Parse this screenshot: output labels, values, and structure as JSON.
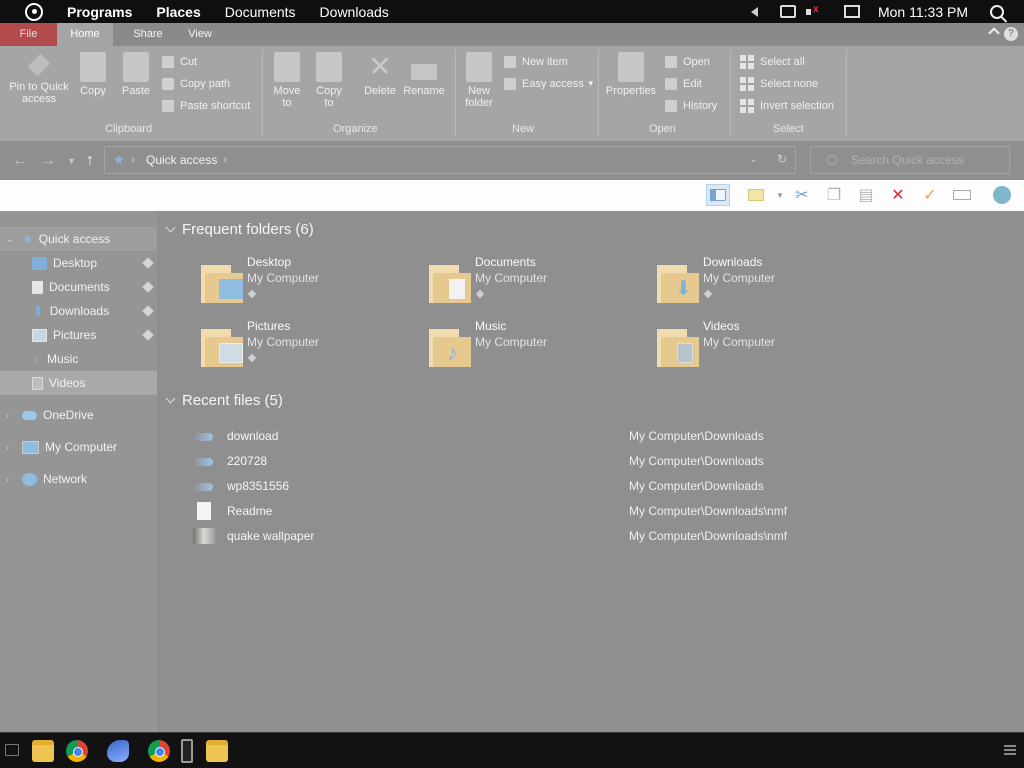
{
  "topbar": {
    "menus": [
      "Programs",
      "Places",
      "Documents",
      "Downloads"
    ],
    "clock": "Mon 11:33 PM"
  },
  "ribbon_tabs": {
    "file": "File",
    "home": "Home",
    "share": "Share",
    "view": "View",
    "help": "?"
  },
  "ribbon": {
    "clipboard": {
      "label": "Clipboard",
      "pin": "Pin to Quick access",
      "copy": "Copy",
      "paste": "Paste",
      "cut": "Cut",
      "copy_path": "Copy path",
      "paste_shortcut": "Paste shortcut"
    },
    "organize": {
      "label": "Organize",
      "move_to": "Move to",
      "copy_to": "Copy to",
      "delete": "Delete",
      "rename": "Rename"
    },
    "new": {
      "label": "New",
      "new_folder": "New folder",
      "new_item": "New item",
      "easy_access": "Easy access"
    },
    "open": {
      "label": "Open",
      "properties": "Properties",
      "open": "Open",
      "edit": "Edit",
      "history": "History"
    },
    "select": {
      "label": "Select",
      "select_all": "Select all",
      "select_none": "Select none",
      "invert": "Invert selection"
    }
  },
  "address": {
    "location": "Quick access",
    "search_placeholder": "Search Quick access"
  },
  "nav": {
    "quick_access": "Quick access",
    "items": [
      {
        "label": "Desktop",
        "pinned": true,
        "icon": "desktop-icon"
      },
      {
        "label": "Documents",
        "pinned": true,
        "icon": "documents-icon"
      },
      {
        "label": "Downloads",
        "pinned": true,
        "icon": "downloads-icon"
      },
      {
        "label": "Pictures",
        "pinned": true,
        "icon": "pictures-icon"
      },
      {
        "label": "Music",
        "pinned": false,
        "icon": "music-icon"
      },
      {
        "label": "Videos",
        "pinned": false,
        "icon": "videos-icon"
      }
    ],
    "onedrive": "OneDrive",
    "my_computer": "My Computer",
    "network": "Network"
  },
  "main": {
    "frequent_title": "Frequent folders (6)",
    "folders": [
      {
        "name": "Desktop",
        "location": "My Computer",
        "pinned": true,
        "icon": "desktop-folder-icon"
      },
      {
        "name": "Documents",
        "location": "My Computer",
        "pinned": true,
        "icon": "documents-folder-icon"
      },
      {
        "name": "Downloads",
        "location": "My Computer",
        "pinned": true,
        "icon": "downloads-folder-icon"
      },
      {
        "name": "Pictures",
        "location": "My Computer",
        "pinned": true,
        "icon": "pictures-folder-icon"
      },
      {
        "name": "Music",
        "location": "My Computer",
        "pinned": false,
        "icon": "music-folder-icon"
      },
      {
        "name": "Videos",
        "location": "My Computer",
        "pinned": false,
        "icon": "videos-folder-icon"
      }
    ],
    "recent_title": "Recent files (5)",
    "recent": [
      {
        "name": "download",
        "path": "My Computer\\Downloads",
        "icon": "image-file-icon"
      },
      {
        "name": "220728",
        "path": "My Computer\\Downloads",
        "icon": "image-file-icon"
      },
      {
        "name": "wp8351556",
        "path": "My Computer\\Downloads",
        "icon": "image-file-icon"
      },
      {
        "name": "Readme",
        "path": "My Computer\\Downloads\\nmf",
        "icon": "text-file-icon"
      },
      {
        "name": "quake wallpaper",
        "path": "My Computer\\Downloads\\nmf",
        "icon": "image-file-icon"
      }
    ]
  },
  "colors": {
    "accent": "#8fb4dc",
    "file_tab": "#b24b4b",
    "delete_red": "#e0263a",
    "check_orange": "#f0a050"
  }
}
